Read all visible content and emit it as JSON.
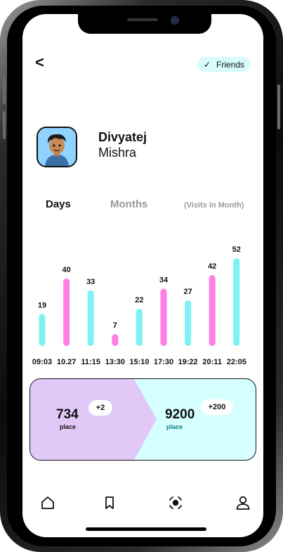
{
  "header": {
    "back_label": "<",
    "friends_label": "Friends"
  },
  "profile": {
    "first_name": "Divyatej",
    "last_name": "Mishra"
  },
  "tabs": {
    "days": "Days",
    "months": "Months",
    "visits": "(Visits in Month)"
  },
  "chart_data": {
    "type": "bar",
    "categories": [
      "09:03",
      "10.27",
      "11:15",
      "13:30",
      "15:10",
      "17:30",
      "19:22",
      "20:11",
      "22:05"
    ],
    "values": [
      19,
      40,
      33,
      7,
      22,
      34,
      27,
      42,
      52
    ],
    "bar_colors": [
      "#7ef2f3",
      "#ff7fe6",
      "#7ef2f3",
      "#ff7fe6",
      "#7ef2f3",
      "#ff7fe6",
      "#7ef2f3",
      "#ff7fe6",
      "#7ef2f3"
    ]
  },
  "stats": {
    "left": {
      "value": "734",
      "label": "place",
      "delta": "+2"
    },
    "right": {
      "value": "9200",
      "label": "place",
      "delta": "+200"
    }
  },
  "colors": {
    "cyan": "#7ef2f3",
    "pink": "#ff7fe6",
    "lavender": "#e2c8f6",
    "light_cyan": "#d6ffff"
  },
  "bottom_nav": [
    "home-icon",
    "bookmark-icon",
    "record-icon",
    "profile-icon"
  ]
}
